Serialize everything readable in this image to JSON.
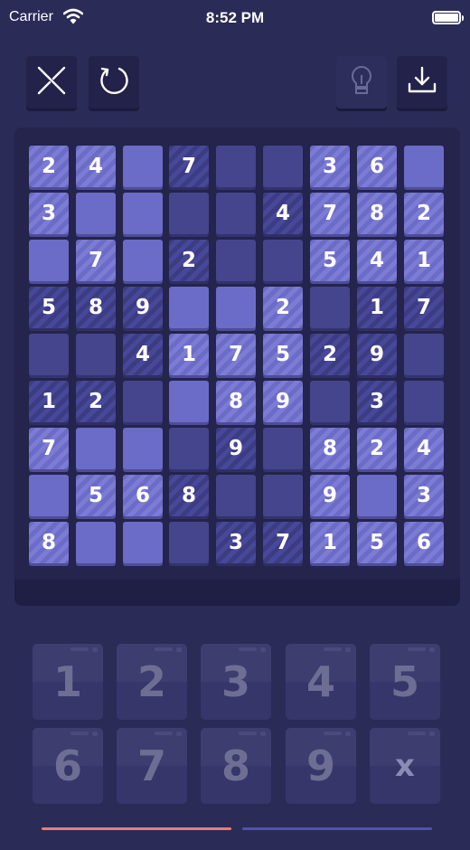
{
  "status_bar": {
    "carrier": "Carrier",
    "time": "8:52 PM"
  },
  "toolbar": {
    "icons": [
      "close-x-icon",
      "restart-icon",
      "hint-lightbulb-icon",
      "download-icon"
    ]
  },
  "board": {
    "grid": [
      [
        "2",
        "4",
        "",
        "7",
        "",
        "",
        "3",
        "6",
        ""
      ],
      [
        "3",
        "",
        "",
        "",
        "",
        "4",
        "7",
        "8",
        "2"
      ],
      [
        "",
        "7",
        "",
        "2",
        "",
        "",
        "5",
        "4",
        "1"
      ],
      [
        "5",
        "8",
        "9",
        "",
        "",
        "2",
        "",
        "1",
        "7"
      ],
      [
        "",
        "",
        "4",
        "1",
        "7",
        "5",
        "2",
        "9",
        ""
      ],
      [
        "1",
        "2",
        "",
        "",
        "8",
        "9",
        "",
        "3",
        ""
      ],
      [
        "7",
        "",
        "",
        "",
        "9",
        "",
        "8",
        "2",
        "4"
      ],
      [
        "",
        "5",
        "6",
        "8",
        "",
        "",
        "9",
        "",
        "3"
      ],
      [
        "8",
        "",
        "",
        "",
        "3",
        "7",
        "1",
        "5",
        "6"
      ]
    ]
  },
  "keypad": {
    "keys": [
      "1",
      "2",
      "3",
      "4",
      "5",
      "6",
      "7",
      "8",
      "9",
      "x"
    ]
  },
  "colors": {
    "background": "#2b2b58",
    "cell_light": "#6b6bc8",
    "cell_dark": "#45458e",
    "tab_active": "#e0827a",
    "tab_inactive": "#5252a8"
  }
}
